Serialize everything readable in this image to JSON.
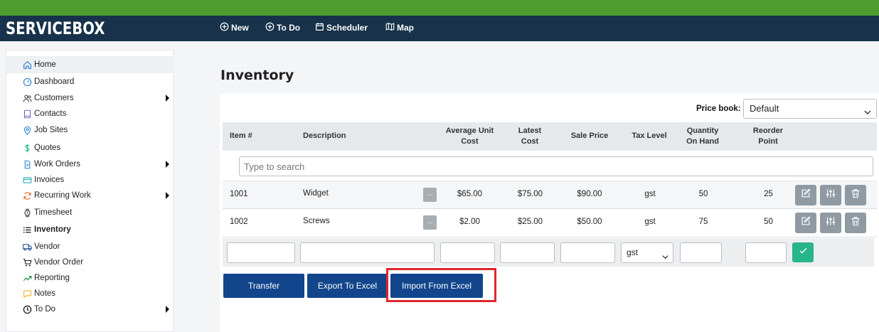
{
  "app": {
    "logo": "SERVICEBOX"
  },
  "nav": {
    "new": "New",
    "todo": "To Do",
    "scheduler": "Scheduler",
    "map": "Map"
  },
  "sidebar": {
    "items": [
      {
        "label": "Home",
        "icon": "home-icon"
      },
      {
        "label": "Dashboard",
        "icon": "gauge-icon"
      },
      {
        "label": "Customers",
        "icon": "users-icon"
      },
      {
        "label": "Contacts",
        "icon": "book-icon"
      },
      {
        "label": "Job Sites",
        "icon": "map-pin-icon"
      },
      {
        "label": "Quotes",
        "icon": "dollar-icon"
      },
      {
        "label": "Work Orders",
        "icon": "document-icon"
      },
      {
        "label": "Invoices",
        "icon": "card-icon"
      },
      {
        "label": "Recurring Work",
        "icon": "refresh-icon"
      },
      {
        "label": "Timesheet",
        "icon": "watch-icon"
      },
      {
        "label": "Inventory",
        "icon": "list-icon"
      },
      {
        "label": "Vendor",
        "icon": "truck-icon"
      },
      {
        "label": "Vendor Order",
        "icon": "cart-icon"
      },
      {
        "label": "Reporting",
        "icon": "trend-icon"
      },
      {
        "label": "Notes",
        "icon": "chat-icon"
      },
      {
        "label": "To Do",
        "icon": "clock-icon"
      }
    ]
  },
  "page": {
    "title": "Inventory"
  },
  "price_book": {
    "label": "Price book:",
    "value": "Default"
  },
  "table": {
    "headers": {
      "item": "Item #",
      "description": "Description",
      "avg_cost_1": "Average Unit",
      "avg_cost_2": "Cost",
      "latest_1": "Latest",
      "latest_2": "Cost",
      "sale": "Sale Price",
      "tax": "Tax Level",
      "qty_1": "Quantity",
      "qty_2": "On Hand",
      "reorder_1": "Reorder",
      "reorder_2": "Point"
    },
    "search_placeholder": "Type to search",
    "rows": [
      {
        "item": "1001",
        "description": "Widget",
        "dots": "...",
        "avg_cost": "$65.00",
        "latest_cost": "$75.00",
        "sale_price": "$90.00",
        "tax": "gst",
        "qty": "50",
        "reorder": "25"
      },
      {
        "item": "1002",
        "description": "Screws",
        "dots": "...",
        "avg_cost": "$2.00",
        "latest_cost": "$25.00",
        "sale_price": "$50.00",
        "tax": "gst",
        "qty": "75",
        "reorder": "50"
      }
    ],
    "new_row_tax": "gst"
  },
  "actions": {
    "transfer": "Transfer",
    "export": "Export To Excel",
    "import": "Import From Excel"
  },
  "colors": {
    "top_strip": "#4f9d2f",
    "navbar": "#17324a",
    "primary_button": "#12458c",
    "confirm_button": "#27b58a",
    "highlight": "#e0262b"
  }
}
